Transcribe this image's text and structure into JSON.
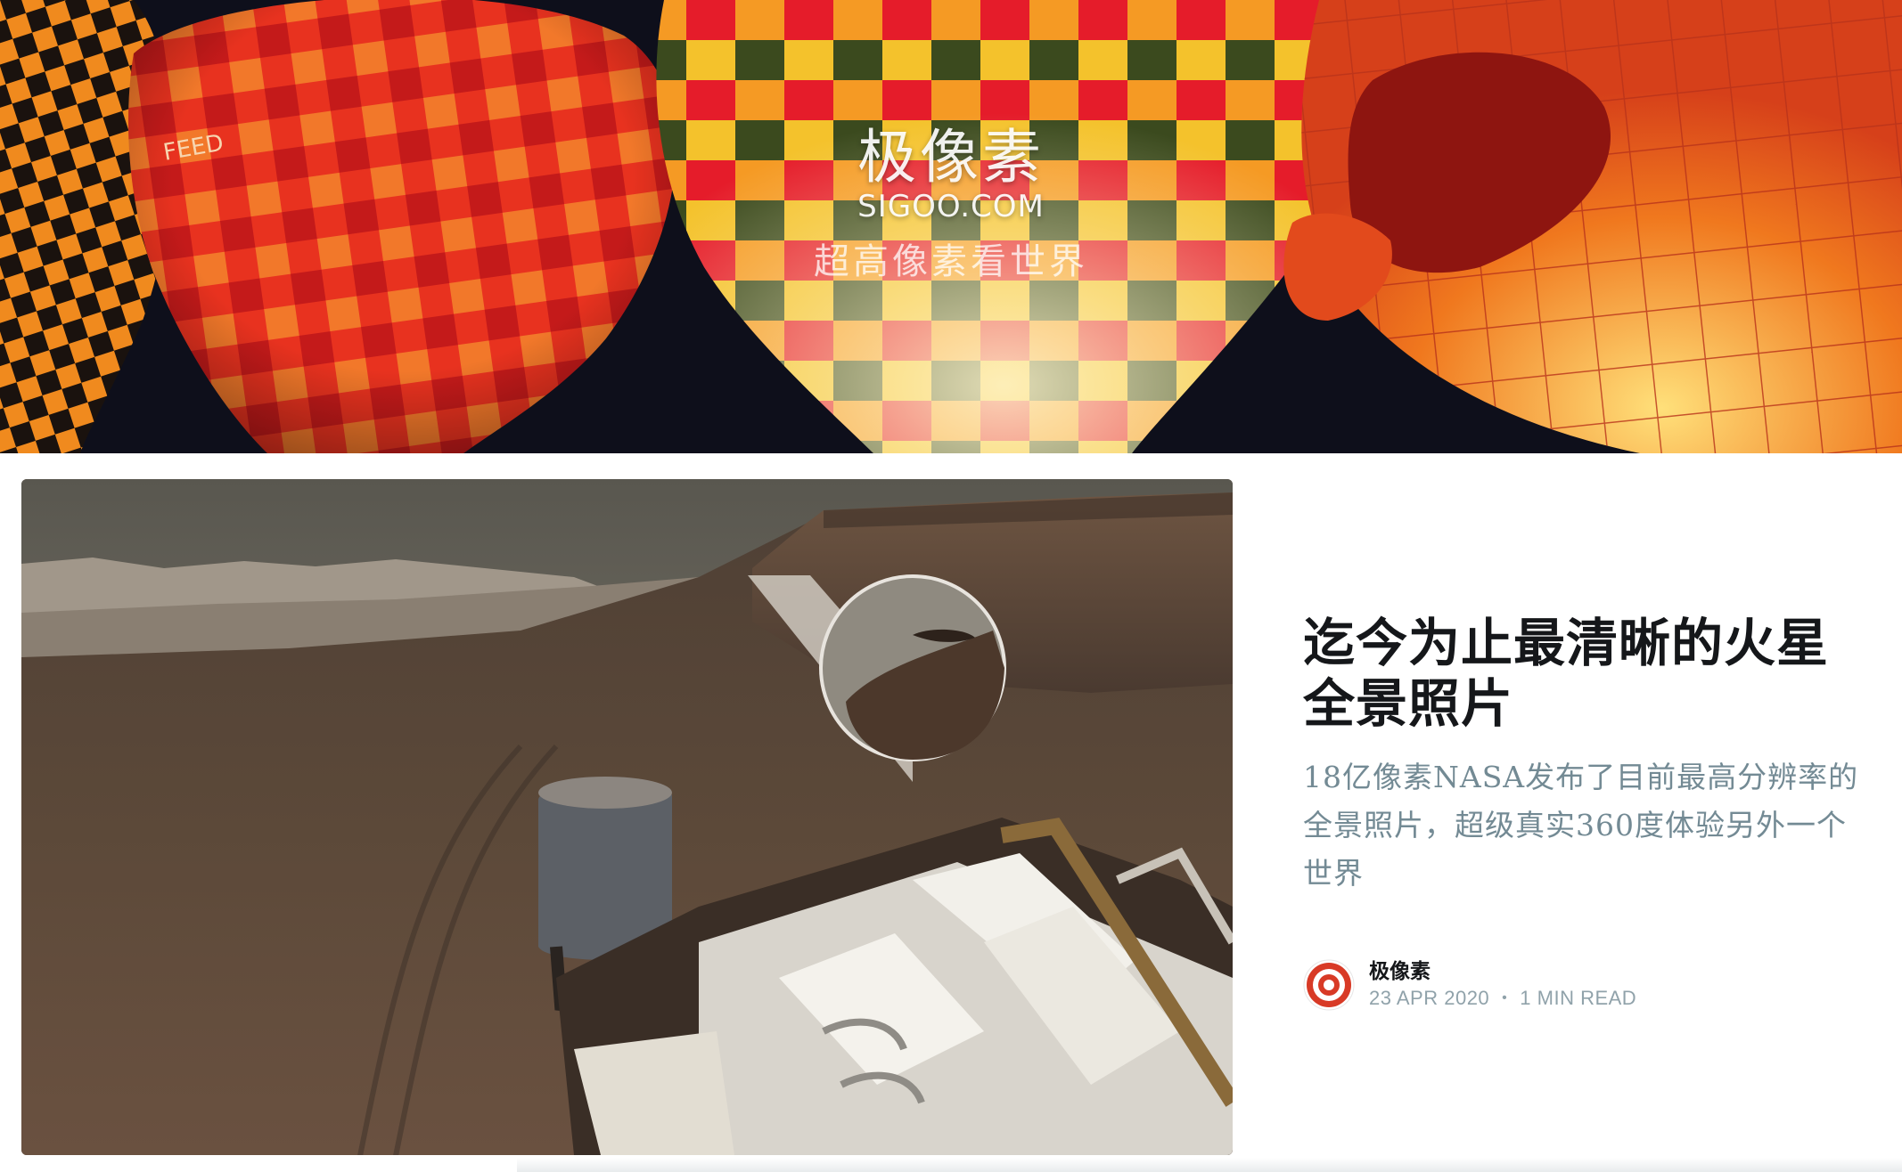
{
  "site": {
    "logo_cn": "极像素",
    "logo_en": "SIGOO.COM",
    "slogan": "超高像素看世界"
  },
  "post": {
    "title": "迄今为止最清晰的火星全景照片",
    "excerpt": "18亿像素NASA发布了目前最高分辨率的全景照片，超级真实360度体验另外一个世界",
    "author": "极像素",
    "date": "23 APR 2020",
    "separator": "•",
    "reading_time": "1 MIN READ",
    "image_icon": "mars-panorama-image",
    "avatar_icon": "target-avatar-icon"
  },
  "colors": {
    "title": "#15171a",
    "excerpt": "#738a94",
    "meta": "#90a2aa",
    "avatar_red": "#d83a26"
  }
}
